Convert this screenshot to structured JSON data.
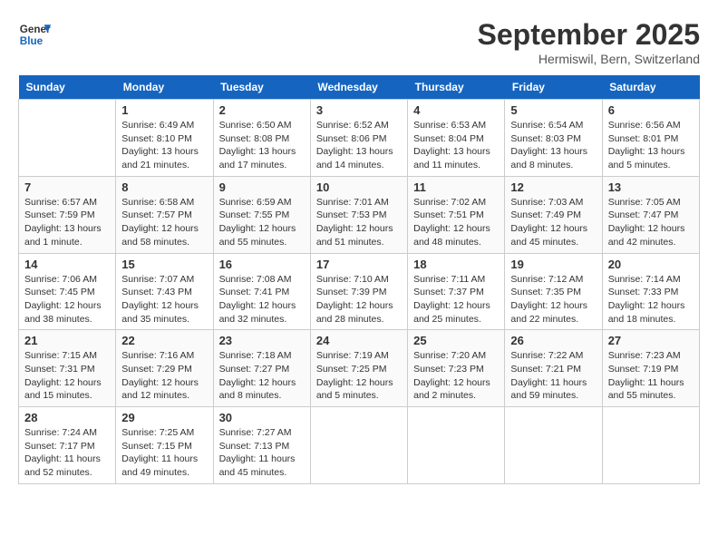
{
  "header": {
    "logo_line1": "General",
    "logo_line2": "Blue",
    "month": "September 2025",
    "location": "Hermiswil, Bern, Switzerland"
  },
  "days_of_week": [
    "Sunday",
    "Monday",
    "Tuesday",
    "Wednesday",
    "Thursday",
    "Friday",
    "Saturday"
  ],
  "weeks": [
    [
      {
        "day": "",
        "info": ""
      },
      {
        "day": "1",
        "info": "Sunrise: 6:49 AM\nSunset: 8:10 PM\nDaylight: 13 hours\nand 21 minutes."
      },
      {
        "day": "2",
        "info": "Sunrise: 6:50 AM\nSunset: 8:08 PM\nDaylight: 13 hours\nand 17 minutes."
      },
      {
        "day": "3",
        "info": "Sunrise: 6:52 AM\nSunset: 8:06 PM\nDaylight: 13 hours\nand 14 minutes."
      },
      {
        "day": "4",
        "info": "Sunrise: 6:53 AM\nSunset: 8:04 PM\nDaylight: 13 hours\nand 11 minutes."
      },
      {
        "day": "5",
        "info": "Sunrise: 6:54 AM\nSunset: 8:03 PM\nDaylight: 13 hours\nand 8 minutes."
      },
      {
        "day": "6",
        "info": "Sunrise: 6:56 AM\nSunset: 8:01 PM\nDaylight: 13 hours\nand 5 minutes."
      }
    ],
    [
      {
        "day": "7",
        "info": "Sunrise: 6:57 AM\nSunset: 7:59 PM\nDaylight: 13 hours\nand 1 minute."
      },
      {
        "day": "8",
        "info": "Sunrise: 6:58 AM\nSunset: 7:57 PM\nDaylight: 12 hours\nand 58 minutes."
      },
      {
        "day": "9",
        "info": "Sunrise: 6:59 AM\nSunset: 7:55 PM\nDaylight: 12 hours\nand 55 minutes."
      },
      {
        "day": "10",
        "info": "Sunrise: 7:01 AM\nSunset: 7:53 PM\nDaylight: 12 hours\nand 51 minutes."
      },
      {
        "day": "11",
        "info": "Sunrise: 7:02 AM\nSunset: 7:51 PM\nDaylight: 12 hours\nand 48 minutes."
      },
      {
        "day": "12",
        "info": "Sunrise: 7:03 AM\nSunset: 7:49 PM\nDaylight: 12 hours\nand 45 minutes."
      },
      {
        "day": "13",
        "info": "Sunrise: 7:05 AM\nSunset: 7:47 PM\nDaylight: 12 hours\nand 42 minutes."
      }
    ],
    [
      {
        "day": "14",
        "info": "Sunrise: 7:06 AM\nSunset: 7:45 PM\nDaylight: 12 hours\nand 38 minutes."
      },
      {
        "day": "15",
        "info": "Sunrise: 7:07 AM\nSunset: 7:43 PM\nDaylight: 12 hours\nand 35 minutes."
      },
      {
        "day": "16",
        "info": "Sunrise: 7:08 AM\nSunset: 7:41 PM\nDaylight: 12 hours\nand 32 minutes."
      },
      {
        "day": "17",
        "info": "Sunrise: 7:10 AM\nSunset: 7:39 PM\nDaylight: 12 hours\nand 28 minutes."
      },
      {
        "day": "18",
        "info": "Sunrise: 7:11 AM\nSunset: 7:37 PM\nDaylight: 12 hours\nand 25 minutes."
      },
      {
        "day": "19",
        "info": "Sunrise: 7:12 AM\nSunset: 7:35 PM\nDaylight: 12 hours\nand 22 minutes."
      },
      {
        "day": "20",
        "info": "Sunrise: 7:14 AM\nSunset: 7:33 PM\nDaylight: 12 hours\nand 18 minutes."
      }
    ],
    [
      {
        "day": "21",
        "info": "Sunrise: 7:15 AM\nSunset: 7:31 PM\nDaylight: 12 hours\nand 15 minutes."
      },
      {
        "day": "22",
        "info": "Sunrise: 7:16 AM\nSunset: 7:29 PM\nDaylight: 12 hours\nand 12 minutes."
      },
      {
        "day": "23",
        "info": "Sunrise: 7:18 AM\nSunset: 7:27 PM\nDaylight: 12 hours\nand 8 minutes."
      },
      {
        "day": "24",
        "info": "Sunrise: 7:19 AM\nSunset: 7:25 PM\nDaylight: 12 hours\nand 5 minutes."
      },
      {
        "day": "25",
        "info": "Sunrise: 7:20 AM\nSunset: 7:23 PM\nDaylight: 12 hours\nand 2 minutes."
      },
      {
        "day": "26",
        "info": "Sunrise: 7:22 AM\nSunset: 7:21 PM\nDaylight: 11 hours\nand 59 minutes."
      },
      {
        "day": "27",
        "info": "Sunrise: 7:23 AM\nSunset: 7:19 PM\nDaylight: 11 hours\nand 55 minutes."
      }
    ],
    [
      {
        "day": "28",
        "info": "Sunrise: 7:24 AM\nSunset: 7:17 PM\nDaylight: 11 hours\nand 52 minutes."
      },
      {
        "day": "29",
        "info": "Sunrise: 7:25 AM\nSunset: 7:15 PM\nDaylight: 11 hours\nand 49 minutes."
      },
      {
        "day": "30",
        "info": "Sunrise: 7:27 AM\nSunset: 7:13 PM\nDaylight: 11 hours\nand 45 minutes."
      },
      {
        "day": "",
        "info": ""
      },
      {
        "day": "",
        "info": ""
      },
      {
        "day": "",
        "info": ""
      },
      {
        "day": "",
        "info": ""
      }
    ]
  ]
}
